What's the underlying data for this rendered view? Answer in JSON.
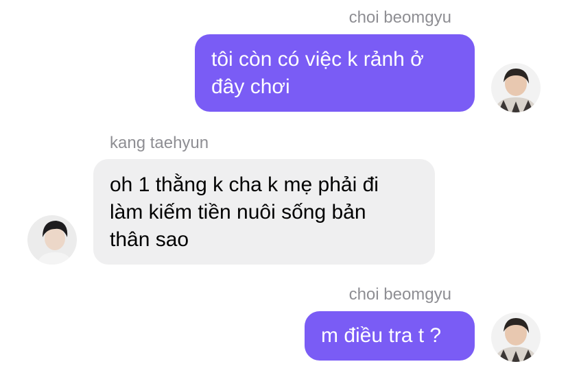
{
  "conversation": {
    "messages": [
      {
        "sender": "choi beomgyu",
        "direction": "outgoing",
        "lines": [
          "tôi còn có việc k rảnh ở",
          "đây chơi"
        ]
      },
      {
        "sender": "kang taehyun",
        "direction": "incoming",
        "lines": [
          "oh 1 thằng k cha k mẹ phải đi",
          "làm kiếm tiền nuôi sống bản",
          "thân sao"
        ]
      },
      {
        "sender": "choi beomgyu",
        "direction": "outgoing",
        "lines": [
          "m điều tra t ?"
        ]
      }
    ]
  },
  "colors": {
    "outgoing_bubble": "#7a5cf5",
    "incoming_bubble": "#efeff0",
    "sender_name": "#8e8e93"
  }
}
